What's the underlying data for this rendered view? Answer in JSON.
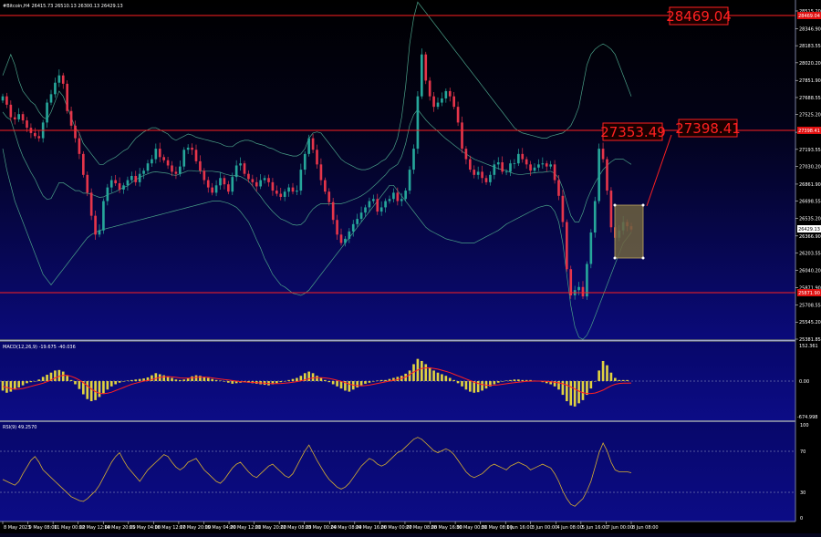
{
  "header": {
    "symbol_line": "#Bitcoin,H4  26415.73 26510.13 26300.13 26429.13"
  },
  "price_axis": {
    "ticks": [
      "28515.20",
      "28346.90",
      "28183.55",
      "28020.20",
      "27851.90",
      "27688.55",
      "27525.20",
      "27356.90",
      "27193.55",
      "27030.20",
      "26861.90",
      "26698.55",
      "26535.20",
      "26366.90",
      "26203.55",
      "26040.20",
      "25871.90",
      "25708.55",
      "25545.20",
      "25381.85"
    ],
    "current_price_tag": "26429.13",
    "red_level_tags": [
      "28469.04",
      "27398.41",
      "25871.90"
    ]
  },
  "annotations": {
    "labels": [
      "28469.04",
      "27353.49",
      "27398.41"
    ]
  },
  "macd": {
    "label": "MACD(12,26,9) -19.675 -40.036",
    "ticks": [
      "152.361",
      "0.00",
      "-674.998"
    ]
  },
  "rsi": {
    "label": "RSI(9) 49.2570",
    "ticks": [
      "100",
      "70",
      "30",
      "0"
    ]
  },
  "time_axis": {
    "labels": [
      "8 May 2023",
      "9 May 08:00",
      "11 May 00:00",
      "12 May 12:00",
      "14 May 20:00",
      "15 May 04:00",
      "16 May 12:00",
      "17 May 20:00",
      "19 May 04:00",
      "20 May 12:00",
      "21 May 20:00",
      "22 May 08:00",
      "23 May 00:00",
      "24 May 08:00",
      "24 May 16:00",
      "26 May 00:00",
      "27 May 08:00",
      "28 May 16:00",
      "30 May 00:00",
      "31 May 08:00",
      "1 Jun 16:00",
      "3 Jun 00:00",
      "4 Jun 08:00",
      "5 Jun 16:00",
      "7 Jun 00:00",
      "8 Jun 08:00"
    ]
  },
  "colors": {
    "background_top": "#000000",
    "background_bottom": "#0a0a7a",
    "bull_candle": "#26a69a",
    "bear_candle": "#e5354a",
    "bollinger": "#4aa088",
    "level_line": "#ff2020",
    "macd_hist": "#e0d240",
    "macd_signal": "#ff2020",
    "rsi_line": "#d8b030"
  },
  "chart_data": {
    "type": "candlestick",
    "y_range": [
      25381.85,
      28515.2
    ],
    "close_series": [
      27700,
      27620,
      27500,
      27480,
      27530,
      27470,
      27400,
      27350,
      27320,
      27300,
      27450,
      27640,
      27720,
      27830,
      27900,
      27820,
      27560,
      27420,
      27300,
      27150,
      26950,
      26780,
      26560,
      26380,
      26420,
      26700,
      26830,
      26900,
      26870,
      26810,
      26850,
      26900,
      26940,
      26880,
      26960,
      26990,
      27060,
      27100,
      27200,
      27120,
      27090,
      27040,
      26980,
      26960,
      27030,
      27190,
      27210,
      27190,
      27080,
      26990,
      26900,
      26830,
      26780,
      26850,
      26920,
      26860,
      26790,
      26930,
      27040,
      27060,
      26960,
      26910,
      26880,
      26840,
      26900,
      26920,
      26880,
      26800,
      26770,
      26740,
      26790,
      26830,
      26790,
      26800,
      27000,
      27150,
      27300,
      27190,
      27050,
      26900,
      26790,
      26690,
      26520,
      26380,
      26300,
      26340,
      26410,
      26480,
      26530,
      26590,
      26640,
      26700,
      26720,
      26600,
      26640,
      26700,
      26720,
      26780,
      26700,
      26720,
      26800,
      27000,
      27200,
      27700,
      28100,
      27850,
      27700,
      27600,
      27640,
      27680,
      27750,
      27700,
      27600,
      27450,
      27200,
      27100,
      27000,
      26950,
      26980,
      26920,
      26880,
      26950,
      27050,
      27070,
      26980,
      26980,
      27060,
      27060,
      27150,
      27100,
      27050,
      26990,
      27020,
      27050,
      27060,
      27030,
      27050,
      26900,
      26750,
      26500,
      26050,
      25800,
      25850,
      25880,
      25790,
      26100,
      26400,
      26700,
      27200,
      27100,
      26800,
      26450,
      26350,
      26420,
      26500,
      26460,
      26429
    ],
    "bollinger_upper_approx": [
      27900,
      28000,
      28100,
      28000,
      27850,
      27750,
      27700,
      27650,
      27620,
      27550,
      27500,
      27480,
      27550,
      27650,
      27750,
      27700,
      27600,
      27500,
      27400,
      27350,
      27250,
      27200,
      27150,
      27100,
      27050,
      27050,
      27080,
      27100,
      27120,
      27150,
      27180,
      27200,
      27250,
      27300,
      27330,
      27360,
      27380,
      27400,
      27400,
      27380,
      27360,
      27340,
      27300,
      27280,
      27300,
      27320,
      27340,
      27330,
      27310,
      27300,
      27290,
      27280,
      27270,
      27260,
      27250,
      27230,
      27220,
      27220,
      27250,
      27270,
      27280,
      27280,
      27270,
      27250,
      27240,
      27230,
      27210,
      27200,
      27180,
      27160,
      27150,
      27140,
      27130,
      27130,
      27150,
      27200,
      27300,
      27350,
      27360,
      27350,
      27300,
      27250,
      27200,
      27150,
      27100,
      27070,
      27050,
      27030,
      27010,
      27000,
      27000,
      27010,
      27030,
      27050,
      27080,
      27100,
      27150,
      27200,
      27300,
      27500,
      27800,
      28200,
      28450,
      28600,
      28550,
      28500,
      28450,
      28400,
      28350,
      28300,
      28250,
      28200,
      28150,
      28100,
      28050,
      28000,
      27950,
      27900,
      27850,
      27800,
      27750,
      27700,
      27650,
      27600,
      27550,
      27500,
      27450,
      27400,
      27370,
      27350,
      27340,
      27330,
      27320,
      27310,
      27300,
      27300,
      27320,
      27330,
      27340,
      27350,
      27380,
      27420,
      27500,
      27600,
      27800,
      28000,
      28100,
      28150,
      28180,
      28200,
      28180,
      28150,
      28100,
      28000,
      27900,
      27800,
      27700
    ],
    "bollinger_lower_approx": [
      27200,
      27000,
      26850,
      26700,
      26600,
      26500,
      26400,
      26300,
      26200,
      26100,
      26000,
      25950,
      25900,
      25950,
      26000,
      26050,
      26100,
      26150,
      26200,
      26250,
      26300,
      26350,
      26380,
      26400,
      26420,
      26430,
      26440,
      26450,
      26460,
      26470,
      26480,
      26490,
      26500,
      26510,
      26520,
      26530,
      26540,
      26550,
      26560,
      26570,
      26580,
      26590,
      26600,
      26610,
      26620,
      26630,
      26640,
      26650,
      26660,
      26670,
      26680,
      26690,
      26700,
      26700,
      26700,
      26690,
      26680,
      26660,
      26640,
      26600,
      26550,
      26500,
      26420,
      26330,
      26250,
      26150,
      26080,
      26000,
      25950,
      25900,
      25880,
      25850,
      25820,
      25810,
      25800,
      25820,
      25850,
      25900,
      25950,
      26000,
      26050,
      26100,
      26150,
      26200,
      26250,
      26300,
      26350,
      26400,
      26450,
      26500,
      26550,
      26600,
      26650,
      26700,
      26750,
      26800,
      26850,
      26850,
      26800,
      26750,
      26700,
      26650,
      26600,
      26550,
      26500,
      26450,
      26420,
      26400,
      26380,
      26360,
      26340,
      26330,
      26320,
      26310,
      26300,
      26300,
      26300,
      26300,
      26320,
      26340,
      26360,
      26380,
      26400,
      26420,
      26450,
      26480,
      26500,
      26520,
      26540,
      26560,
      26580,
      26600,
      26620,
      26640,
      26650,
      26660,
      26650,
      26600,
      26500,
      26300,
      26000,
      25700,
      25500,
      25400,
      25380,
      25420,
      25500,
      25600,
      25700,
      25800,
      25900,
      26000,
      26100,
      26200,
      26300,
      26350,
      26400
    ],
    "macd_histogram_approx": [
      -180,
      -220,
      -200,
      -160,
      -120,
      -80,
      -40,
      -20,
      0,
      30,
      80,
      120,
      160,
      200,
      210,
      180,
      100,
      20,
      -60,
      -150,
      -250,
      -340,
      -380,
      -360,
      -300,
      -230,
      -160,
      -100,
      -60,
      -30,
      -10,
      10,
      20,
      30,
      40,
      50,
      70,
      110,
      150,
      130,
      110,
      90,
      60,
      30,
      20,
      30,
      60,
      90,
      110,
      100,
      80,
      60,
      40,
      20,
      10,
      -10,
      -30,
      -50,
      -40,
      -30,
      -20,
      -30,
      -40,
      -50,
      -60,
      -70,
      -80,
      -60,
      -40,
      -20,
      0,
      20,
      40,
      60,
      100,
      150,
      180,
      150,
      100,
      60,
      20,
      -20,
      -60,
      -100,
      -140,
      -180,
      -200,
      -160,
      -120,
      -80,
      -50,
      -30,
      -10,
      10,
      20,
      20,
      40,
      60,
      80,
      100,
      140,
      200,
      320,
      420,
      380,
      320,
      260,
      200,
      160,
      130,
      100,
      60,
      20,
      -40,
      -100,
      -160,
      -200,
      -220,
      -210,
      -180,
      -140,
      -100,
      -60,
      -30,
      -10,
      10,
      20,
      30,
      30,
      20,
      20,
      20,
      10,
      0,
      -20,
      -40,
      -60,
      -100,
      -160,
      -260,
      -380,
      -460,
      -480,
      -420,
      -360,
      -260,
      -140,
      0,
      200,
      380,
      300,
      160,
      60,
      20,
      20,
      20
    ],
    "macd_signal_approx": [
      -100,
      -120,
      -140,
      -150,
      -150,
      -140,
      -120,
      -100,
      -80,
      -60,
      -40,
      -10,
      20,
      60,
      90,
      110,
      110,
      90,
      60,
      20,
      -30,
      -90,
      -150,
      -200,
      -230,
      -240,
      -230,
      -210,
      -180,
      -150,
      -120,
      -90,
      -60,
      -40,
      -20,
      0,
      10,
      30,
      50,
      70,
      80,
      85,
      80,
      70,
      60,
      55,
      55,
      60,
      70,
      75,
      75,
      70,
      60,
      50,
      40,
      30,
      20,
      10,
      0,
      -10,
      -15,
      -20,
      -25,
      -30,
      -35,
      -40,
      -45,
      -48,
      -48,
      -45,
      -40,
      -32,
      -22,
      -10,
      5,
      25,
      45,
      60,
      65,
      65,
      60,
      50,
      35,
      15,
      -5,
      -30,
      -55,
      -75,
      -85,
      -90,
      -85,
      -75,
      -60,
      -45,
      -30,
      -15,
      0,
      15,
      30,
      50,
      80,
      120,
      170,
      210,
      240,
      250,
      250,
      240,
      225,
      205,
      185,
      160,
      130,
      100,
      70,
      40,
      10,
      -20,
      -45,
      -65,
      -75,
      -80,
      -78,
      -70,
      -60,
      -50,
      -40,
      -30,
      -20,
      -12,
      -6,
      -2,
      0,
      0,
      -2,
      -6,
      -12,
      -20,
      -32,
      -50,
      -75,
      -110,
      -150,
      -190,
      -220,
      -235,
      -235,
      -225,
      -200,
      -170,
      -130,
      -90,
      -60,
      -45,
      -40,
      -38,
      -36
    ],
    "rsi_approx": [
      42,
      40,
      38,
      36,
      40,
      48,
      55,
      62,
      66,
      60,
      52,
      48,
      44,
      40,
      36,
      32,
      28,
      24,
      22,
      20,
      19,
      22,
      26,
      30,
      36,
      44,
      52,
      60,
      66,
      70,
      62,
      55,
      50,
      45,
      40,
      46,
      52,
      56,
      60,
      64,
      68,
      66,
      60,
      55,
      52,
      55,
      60,
      62,
      64,
      58,
      52,
      48,
      44,
      40,
      38,
      42,
      48,
      54,
      58,
      60,
      55,
      50,
      46,
      44,
      48,
      52,
      56,
      58,
      54,
      50,
      46,
      44,
      48,
      56,
      64,
      72,
      78,
      70,
      62,
      55,
      48,
      42,
      38,
      34,
      32,
      34,
      38,
      44,
      50,
      56,
      60,
      64,
      62,
      58,
      56,
      58,
      62,
      66,
      70,
      72,
      76,
      80,
      84,
      86,
      84,
      80,
      76,
      72,
      70,
      72,
      74,
      72,
      68,
      62,
      56,
      50,
      46,
      44,
      46,
      48,
      52,
      56,
      58,
      56,
      54,
      52,
      56,
      58,
      60,
      58,
      56,
      52,
      54,
      56,
      58,
      56,
      54,
      48,
      40,
      30,
      22,
      16,
      14,
      18,
      22,
      30,
      40,
      55,
      70,
      80,
      72,
      60,
      52,
      50,
      50,
      50,
      49
    ]
  }
}
